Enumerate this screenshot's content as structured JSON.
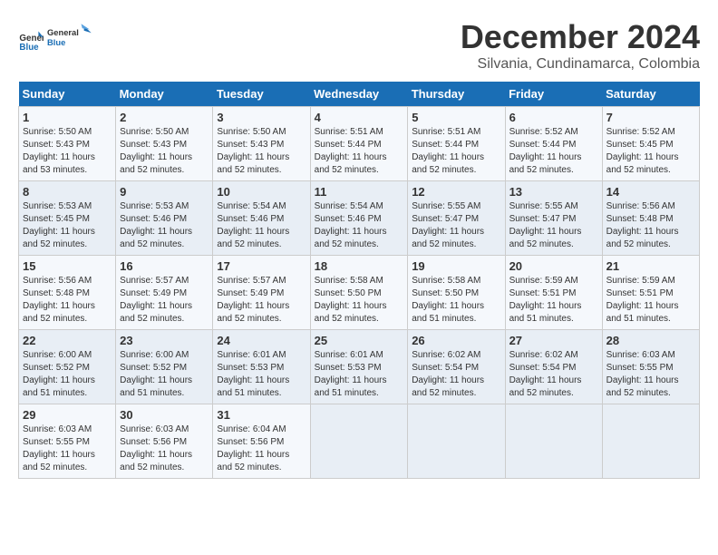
{
  "logo": {
    "line1": "General",
    "line2": "Blue"
  },
  "title": "December 2024",
  "subtitle": "Silvania, Cundinamarca, Colombia",
  "days_of_week": [
    "Sunday",
    "Monday",
    "Tuesday",
    "Wednesday",
    "Thursday",
    "Friday",
    "Saturday"
  ],
  "weeks": [
    [
      {
        "day": "1",
        "sunrise": "5:50 AM",
        "sunset": "5:43 PM",
        "daylight": "11 hours and 53 minutes."
      },
      {
        "day": "2",
        "sunrise": "5:50 AM",
        "sunset": "5:43 PM",
        "daylight": "11 hours and 52 minutes."
      },
      {
        "day": "3",
        "sunrise": "5:50 AM",
        "sunset": "5:43 PM",
        "daylight": "11 hours and 52 minutes."
      },
      {
        "day": "4",
        "sunrise": "5:51 AM",
        "sunset": "5:44 PM",
        "daylight": "11 hours and 52 minutes."
      },
      {
        "day": "5",
        "sunrise": "5:51 AM",
        "sunset": "5:44 PM",
        "daylight": "11 hours and 52 minutes."
      },
      {
        "day": "6",
        "sunrise": "5:52 AM",
        "sunset": "5:44 PM",
        "daylight": "11 hours and 52 minutes."
      },
      {
        "day": "7",
        "sunrise": "5:52 AM",
        "sunset": "5:45 PM",
        "daylight": "11 hours and 52 minutes."
      }
    ],
    [
      {
        "day": "8",
        "sunrise": "5:53 AM",
        "sunset": "5:45 PM",
        "daylight": "11 hours and 52 minutes."
      },
      {
        "day": "9",
        "sunrise": "5:53 AM",
        "sunset": "5:46 PM",
        "daylight": "11 hours and 52 minutes."
      },
      {
        "day": "10",
        "sunrise": "5:54 AM",
        "sunset": "5:46 PM",
        "daylight": "11 hours and 52 minutes."
      },
      {
        "day": "11",
        "sunrise": "5:54 AM",
        "sunset": "5:46 PM",
        "daylight": "11 hours and 52 minutes."
      },
      {
        "day": "12",
        "sunrise": "5:55 AM",
        "sunset": "5:47 PM",
        "daylight": "11 hours and 52 minutes."
      },
      {
        "day": "13",
        "sunrise": "5:55 AM",
        "sunset": "5:47 PM",
        "daylight": "11 hours and 52 minutes."
      },
      {
        "day": "14",
        "sunrise": "5:56 AM",
        "sunset": "5:48 PM",
        "daylight": "11 hours and 52 minutes."
      }
    ],
    [
      {
        "day": "15",
        "sunrise": "5:56 AM",
        "sunset": "5:48 PM",
        "daylight": "11 hours and 52 minutes."
      },
      {
        "day": "16",
        "sunrise": "5:57 AM",
        "sunset": "5:49 PM",
        "daylight": "11 hours and 52 minutes."
      },
      {
        "day": "17",
        "sunrise": "5:57 AM",
        "sunset": "5:49 PM",
        "daylight": "11 hours and 52 minutes."
      },
      {
        "day": "18",
        "sunrise": "5:58 AM",
        "sunset": "5:50 PM",
        "daylight": "11 hours and 52 minutes."
      },
      {
        "day": "19",
        "sunrise": "5:58 AM",
        "sunset": "5:50 PM",
        "daylight": "11 hours and 51 minutes."
      },
      {
        "day": "20",
        "sunrise": "5:59 AM",
        "sunset": "5:51 PM",
        "daylight": "11 hours and 51 minutes."
      },
      {
        "day": "21",
        "sunrise": "5:59 AM",
        "sunset": "5:51 PM",
        "daylight": "11 hours and 51 minutes."
      }
    ],
    [
      {
        "day": "22",
        "sunrise": "6:00 AM",
        "sunset": "5:52 PM",
        "daylight": "11 hours and 51 minutes."
      },
      {
        "day": "23",
        "sunrise": "6:00 AM",
        "sunset": "5:52 PM",
        "daylight": "11 hours and 51 minutes."
      },
      {
        "day": "24",
        "sunrise": "6:01 AM",
        "sunset": "5:53 PM",
        "daylight": "11 hours and 51 minutes."
      },
      {
        "day": "25",
        "sunrise": "6:01 AM",
        "sunset": "5:53 PM",
        "daylight": "11 hours and 51 minutes."
      },
      {
        "day": "26",
        "sunrise": "6:02 AM",
        "sunset": "5:54 PM",
        "daylight": "11 hours and 52 minutes."
      },
      {
        "day": "27",
        "sunrise": "6:02 AM",
        "sunset": "5:54 PM",
        "daylight": "11 hours and 52 minutes."
      },
      {
        "day": "28",
        "sunrise": "6:03 AM",
        "sunset": "5:55 PM",
        "daylight": "11 hours and 52 minutes."
      }
    ],
    [
      {
        "day": "29",
        "sunrise": "6:03 AM",
        "sunset": "5:55 PM",
        "daylight": "11 hours and 52 minutes."
      },
      {
        "day": "30",
        "sunrise": "6:03 AM",
        "sunset": "5:56 PM",
        "daylight": "11 hours and 52 minutes."
      },
      {
        "day": "31",
        "sunrise": "6:04 AM",
        "sunset": "5:56 PM",
        "daylight": "11 hours and 52 minutes."
      },
      null,
      null,
      null,
      null
    ]
  ],
  "labels": {
    "sunrise": "Sunrise:",
    "sunset": "Sunset:",
    "daylight": "Daylight:"
  }
}
